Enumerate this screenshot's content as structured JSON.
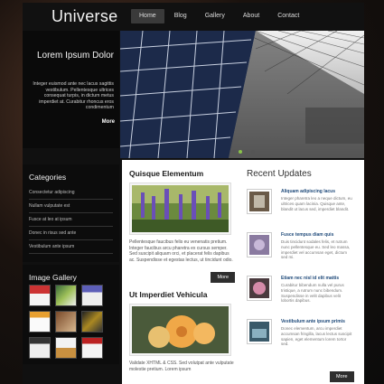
{
  "header": {
    "logo": "Universe",
    "nav": [
      "Home",
      "Blog",
      "Gallery",
      "About",
      "Contact"
    ]
  },
  "hero": {
    "title": "Lorem Ipsum Dolor",
    "text": "Integer euismod ante nec lacus sagittis vestibulum. Pellentesque ultrices consequat turpis, in dictum metus imperdiet at. Curabitur rhoncus eros condimentum",
    "more": "More",
    "slide_count": 4,
    "active_slide": 1
  },
  "sidebar": {
    "categories_title": "Categories",
    "categories": [
      "Consectetur adipiscing",
      "Nullam vulputate est",
      "Fusce at leo at ipsum",
      "Donec in risus sed ante",
      "Vestibulum ante ipsum"
    ],
    "gallery_title": "Image Gallery"
  },
  "posts": [
    {
      "title": "Quisque Elementum",
      "text": "Pellentesque faucibus felis eu venenatis pretium. Integer faucibus arcu pharetra ex cursus semper. Sed suscipit aliquam orci, et placerat felis dapibus ac. Suspendisse et egestas lectus, ut tincidunt odio.",
      "more": "More"
    },
    {
      "title": "Ut Imperdiet Vehicula",
      "text": "Validate XHTML & CSS. Sed volutpat ante vulputate molestie pretium. Lorem ipsum"
    }
  ],
  "updates": {
    "title": "Recent Updates",
    "items": [
      {
        "title": "Aliquam adipiscing lacus",
        "text": "Integer pharetra leo a neque dictum, eu ultrices quam lacinia. Quisque ante, blandit ut lacus sed, imperdiet blandit."
      },
      {
        "title": "Fusce tempus diam quis",
        "text": "Duis tincidunt sodales felis, et rutrum nunc pellentesque eu. Sed leo massa, imperdiet vel accumsan eget, dictum sed mi."
      },
      {
        "title": "Etiam nec nisl id elit mattis",
        "text": "Curabitur bibendum nulla vel purus tristique, a rutrum nunc bibendum. Suspendisse in velit dapibus velit lobortis dapibus."
      },
      {
        "title": "Vestibulum ante ipsum primis",
        "text": "Donec elementum, arcu imperdiet accumsan fringilla, lacus lectus suscipit sapien, eget elementum lorem tortor sed."
      }
    ],
    "more": "More"
  }
}
